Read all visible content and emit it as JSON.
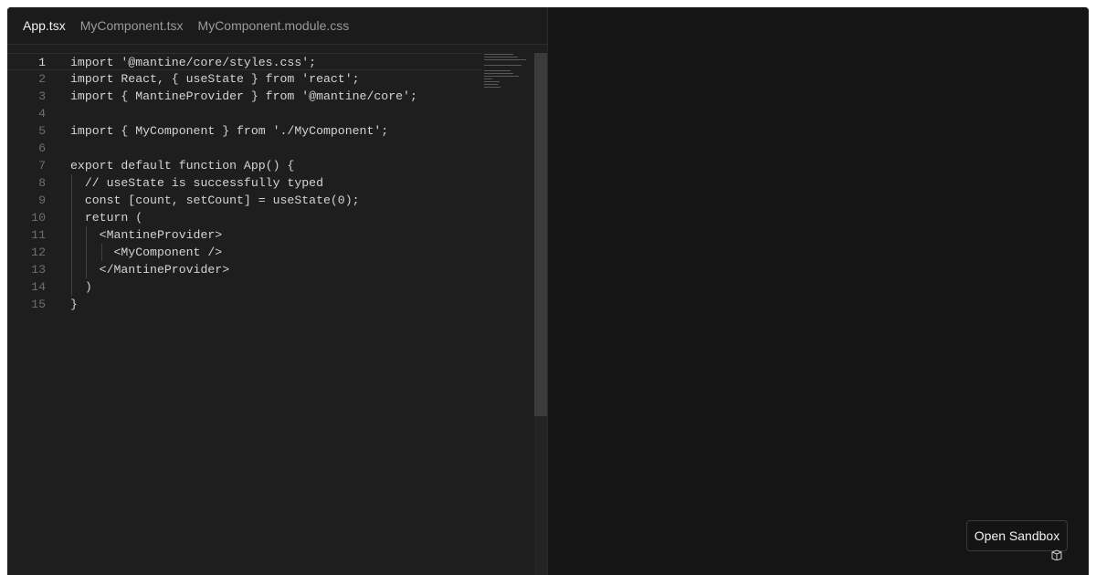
{
  "tabs": [
    {
      "label": "App.tsx",
      "active": true
    },
    {
      "label": "MyComponent.tsx",
      "active": false
    },
    {
      "label": "MyComponent.module.css",
      "active": false
    }
  ],
  "editor": {
    "current_line": 1,
    "lines": [
      {
        "num": "1",
        "text": "import '@mantine/core/styles.css';"
      },
      {
        "num": "2",
        "text": "import React, { useState } from 'react';"
      },
      {
        "num": "3",
        "text": "import { MantineProvider } from '@mantine/core';"
      },
      {
        "num": "4",
        "text": ""
      },
      {
        "num": "5",
        "text": "import { MyComponent } from './MyComponent';"
      },
      {
        "num": "6",
        "text": ""
      },
      {
        "num": "7",
        "text": "export default function App() {"
      },
      {
        "num": "8",
        "text": "  // useState is successfully typed"
      },
      {
        "num": "9",
        "text": "  const [count, setCount] = useState(0);"
      },
      {
        "num": "10",
        "text": "  return ("
      },
      {
        "num": "11",
        "text": "    <MantineProvider>"
      },
      {
        "num": "12",
        "text": "      <MyComponent />"
      },
      {
        "num": "13",
        "text": "    </MantineProvider>"
      },
      {
        "num": "14",
        "text": "  )"
      },
      {
        "num": "15",
        "text": "}"
      }
    ]
  },
  "preview": {
    "open_sandbox_label": "Open Sandbox",
    "sandbox_icon": "codesandbox-cube-icon"
  },
  "colors": {
    "editor_bg": "#1e1e1e",
    "preview_bg": "#151515",
    "text": "#d4d4d4",
    "line_number": "#6e6e6e"
  }
}
